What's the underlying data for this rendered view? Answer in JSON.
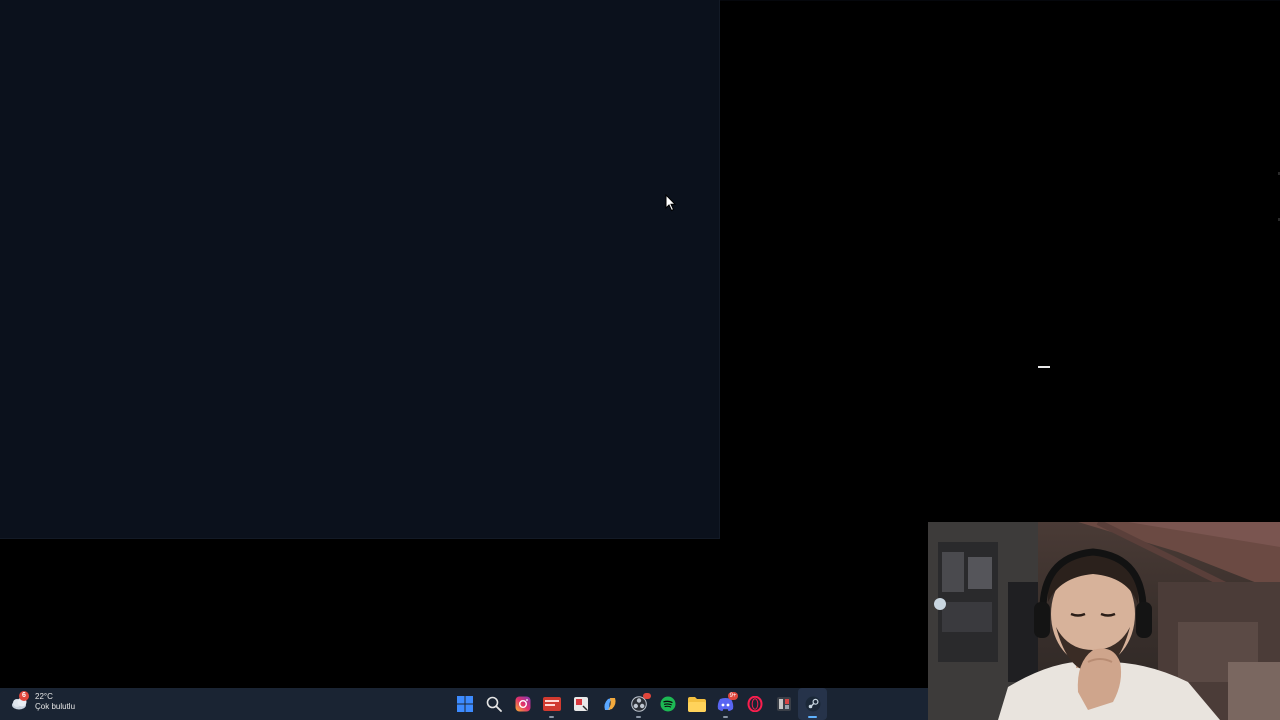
{
  "window": {
    "state": "blank dark window"
  },
  "weather": {
    "temperature": "22°C",
    "condition": "Çok bulutlu",
    "badge": "6",
    "icon": "cloudy-weather-icon"
  },
  "taskbar": {
    "items": [
      {
        "name": "start-button",
        "icon": "windows-logo-icon",
        "color": "#3d8bff"
      },
      {
        "name": "search-button",
        "icon": "search-icon",
        "color": "#e6e6e6"
      },
      {
        "name": "app-instagram",
        "icon": "instagram-icon",
        "color": "#e1306c"
      },
      {
        "name": "app-video-editor",
        "icon": "video-editor-icon",
        "color": "#d13a2f"
      },
      {
        "name": "app-snipping-tool",
        "icon": "snipping-tool-icon",
        "color": "#e8e8e8"
      },
      {
        "name": "app-copilot",
        "icon": "copilot-icon",
        "color": "#5aa7ff"
      },
      {
        "name": "app-obs",
        "icon": "obs-icon",
        "color": "#bfc6d0"
      },
      {
        "name": "app-spotify",
        "icon": "spotify-icon",
        "color": "#1db954"
      },
      {
        "name": "app-file-explorer",
        "icon": "folder-icon",
        "color": "#f4c03f"
      },
      {
        "name": "app-discord",
        "icon": "discord-icon",
        "color": "#5865f2",
        "badge": "9+"
      },
      {
        "name": "app-opera-gx",
        "icon": "opera-gx-icon",
        "color": "#fa1e4e"
      },
      {
        "name": "app-game-launcher",
        "icon": "game-launcher-icon",
        "color": "#c8c8c8"
      },
      {
        "name": "app-steam",
        "icon": "steam-icon",
        "color": "#c7d5e0"
      }
    ]
  },
  "colors": {
    "desktop": "#000000",
    "window": "#0b111c",
    "taskbar": "#1a2433",
    "accent": "#5fb2ff"
  }
}
